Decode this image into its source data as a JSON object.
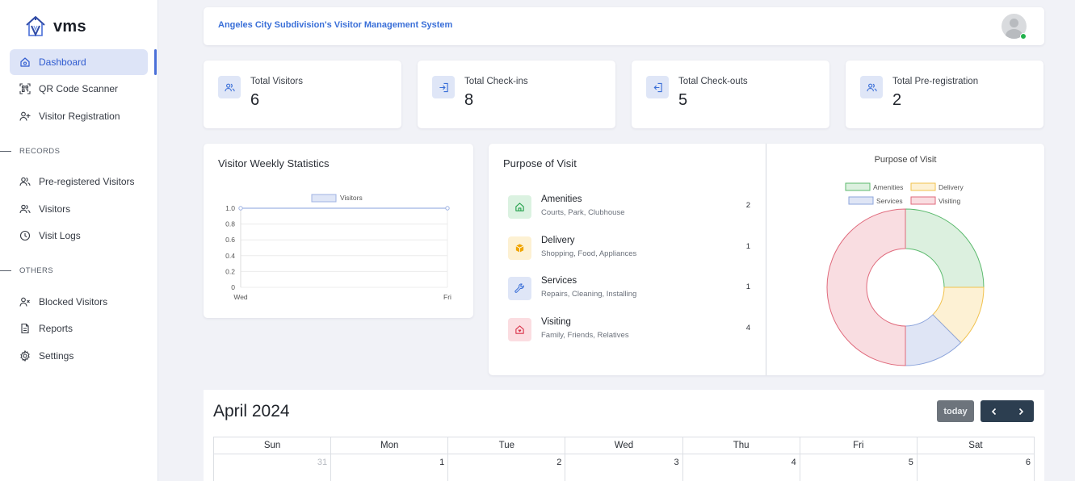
{
  "app": {
    "name": "vms",
    "header_title": "Angeles City Subdivision's Visitor Management System"
  },
  "sidebar": {
    "main_items": [
      {
        "label": "Dashboard",
        "icon": "home-icon",
        "active": true
      },
      {
        "label": "QR Code Scanner",
        "icon": "qr-scan-icon"
      },
      {
        "label": "Visitor Registration",
        "icon": "user-plus-icon"
      }
    ],
    "records_label": "RECORDS",
    "records_items": [
      {
        "label": "Pre-registered Visitors",
        "icon": "users-icon"
      },
      {
        "label": "Visitors",
        "icon": "users-icon"
      },
      {
        "label": "Visit Logs",
        "icon": "clock-icon"
      }
    ],
    "others_label": "OTHERS",
    "others_items": [
      {
        "label": "Blocked Visitors",
        "icon": "user-x-icon"
      },
      {
        "label": "Reports",
        "icon": "document-icon"
      },
      {
        "label": "Settings",
        "icon": "gear-icon"
      }
    ]
  },
  "stats": [
    {
      "label": "Total Visitors",
      "value": "6",
      "icon": "users-icon"
    },
    {
      "label": "Total Check-ins",
      "value": "8",
      "icon": "login-icon"
    },
    {
      "label": "Total Check-outs",
      "value": "5",
      "icon": "logout-icon"
    },
    {
      "label": "Total Pre-registration",
      "value": "2",
      "icon": "users-icon"
    }
  ],
  "weekly": {
    "title": "Visitor Weekly Statistics"
  },
  "purpose": {
    "title": "Purpose of Visit",
    "items": [
      {
        "name": "Amenities",
        "desc": "Courts, Park, Clubhouse",
        "count": "2",
        "icon": "home-icon",
        "color": "#22a04a",
        "bg": "#dbf2e1"
      },
      {
        "name": "Delivery",
        "desc": "Shopping, Food, Appliances",
        "count": "1",
        "icon": "box-icon",
        "color": "#f0a500",
        "bg": "#fdf1d3"
      },
      {
        "name": "Services",
        "desc": "Repairs, Cleaning, Installing",
        "count": "1",
        "icon": "wrench-icon",
        "color": "#3a6fd8",
        "bg": "#dfe6f7"
      },
      {
        "name": "Visiting",
        "desc": "Family, Friends, Relatives",
        "count": "4",
        "icon": "house-heart-icon",
        "color": "#d9334a",
        "bg": "#fbdde1"
      }
    ]
  },
  "chart_data": [
    {
      "type": "line",
      "title": "",
      "series": [
        {
          "name": "Visitors",
          "values": [
            1,
            1
          ]
        }
      ],
      "categories": [
        "Wed",
        "Fri"
      ],
      "ylim": [
        0,
        1.0
      ],
      "yticks": [
        "1.0",
        "0.8",
        "0.6",
        "0.4",
        "0.2",
        "0"
      ],
      "legend": "top",
      "colors": {
        "line": "#9fb3e3",
        "fill": "#dfe6f7"
      }
    },
    {
      "type": "pie",
      "title": "Purpose of Visit",
      "categories": [
        "Amenities",
        "Delivery",
        "Services",
        "Visiting"
      ],
      "values": [
        2,
        1,
        1,
        4
      ],
      "colors": {
        "fills": [
          "#dcf0df",
          "#fdf1d4",
          "#dfe5f5",
          "#f9dde1"
        ],
        "strokes": [
          "#5cba6e",
          "#f1c24e",
          "#8ea6dc",
          "#e06a7c"
        ]
      },
      "legend": "top"
    }
  ],
  "calendar": {
    "title": "April 2024",
    "today_label": "today",
    "weekdays": [
      "Sun",
      "Mon",
      "Tue",
      "Wed",
      "Thu",
      "Fri",
      "Sat"
    ],
    "first_row": [
      "31",
      "1",
      "2",
      "3",
      "4",
      "5",
      "6"
    ]
  }
}
